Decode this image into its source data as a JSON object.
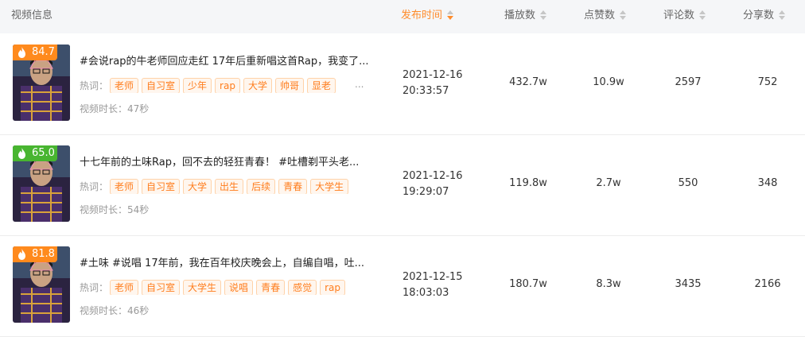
{
  "header": {
    "video_info": "视频信息",
    "publish_time": "发布时间",
    "plays": "播放数",
    "likes": "点赞数",
    "comments": "评论数",
    "shares": "分享数"
  },
  "labels": {
    "hot_words": "热词：",
    "ellipsis": "..."
  },
  "colors": {
    "accent": "#ff8c2b",
    "score_orange": "#ff8a1d",
    "score_green": "#48b530"
  },
  "rows": [
    {
      "score": "84.7",
      "title": "#会说rap的牛老师回应走红 17年后重新唱这首Rap，我变了...",
      "tags": [
        "老师",
        "自习室",
        "少年",
        "rap",
        "大学",
        "帅哥",
        "显老"
      ],
      "duration": "视频时长：47秒",
      "date": "2021-12-16",
      "time": "20:33:57",
      "plays": "432.7w",
      "likes": "10.9w",
      "comments": "2597",
      "shares": "752"
    },
    {
      "score": "65.0",
      "title": "十七年前的土味Rap，回不去的轻狂青春！ #吐槽剃平头老...",
      "tags": [
        "老师",
        "自习室",
        "大学",
        "出生",
        "后续",
        "青春",
        "大学生"
      ],
      "duration": "视频时长：54秒",
      "date": "2021-12-16",
      "time": "19:29:07",
      "plays": "119.8w",
      "likes": "2.7w",
      "comments": "550",
      "shares": "348"
    },
    {
      "score": "81.8",
      "title": "#土味 #说唱 17年前，我在百年校庆晚会上，自编自唱，吐...",
      "tags": [
        "老师",
        "自习室",
        "大学生",
        "说唱",
        "青春",
        "感觉",
        "rap"
      ],
      "duration": "视频时长：46秒",
      "date": "2021-12-15",
      "time": "18:03:03",
      "plays": "180.7w",
      "likes": "8.3w",
      "comments": "3435",
      "shares": "2166"
    }
  ]
}
